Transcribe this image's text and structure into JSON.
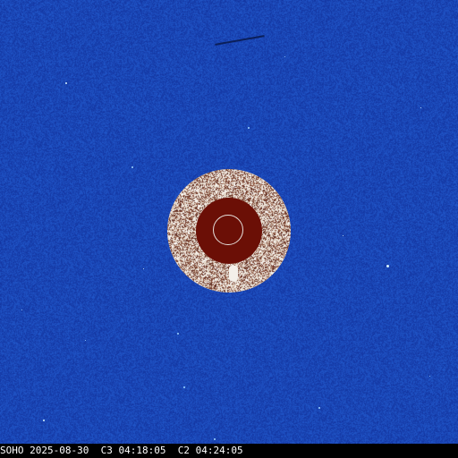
{
  "image": {
    "background_color": "#1a46b5",
    "occulter_color": "#6b0f06",
    "ring_color": "#efe6dc",
    "limb_color": "#e6e0dc"
  },
  "status_bar": {
    "observatory": "SOHO",
    "date": "2025-08-30",
    "c3_label": "C3",
    "c3_time": "04:18:05",
    "c2_label": "C2",
    "c2_time": "04:24:05"
  }
}
